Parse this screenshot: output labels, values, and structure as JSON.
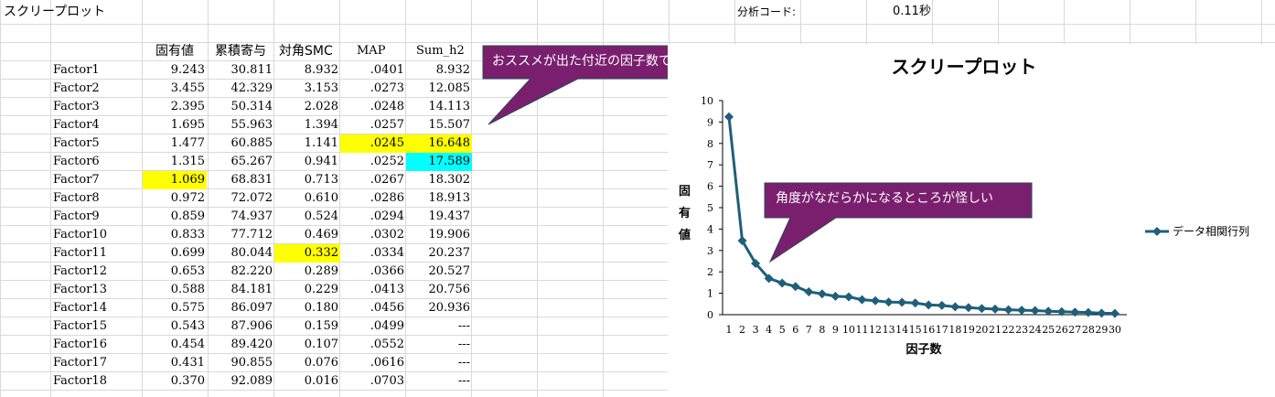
{
  "sheet": {
    "title": "スクリープロット",
    "analysis_code_label": "分析コード:",
    "analysis_time": "0.11秒"
  },
  "table": {
    "headers": [
      "固有値",
      "累積寄与",
      "対角SMC",
      "MAP",
      "Sum_h2"
    ],
    "rows": [
      {
        "factor": "Factor1",
        "eig": "9.243",
        "cum": "30.811",
        "smc": "8.932",
        "map": ".0401",
        "h2": "8.932"
      },
      {
        "factor": "Factor2",
        "eig": "3.455",
        "cum": "42.329",
        "smc": "3.153",
        "map": ".0273",
        "h2": "12.085"
      },
      {
        "factor": "Factor3",
        "eig": "2.395",
        "cum": "50.314",
        "smc": "2.028",
        "map": ".0248",
        "h2": "14.113"
      },
      {
        "factor": "Factor4",
        "eig": "1.695",
        "cum": "55.963",
        "smc": "1.394",
        "map": ".0257",
        "h2": "15.507"
      },
      {
        "factor": "Factor5",
        "eig": "1.477",
        "cum": "60.885",
        "smc": "1.141",
        "map": ".0245",
        "h2": "16.648"
      },
      {
        "factor": "Factor6",
        "eig": "1.315",
        "cum": "65.267",
        "smc": "0.941",
        "map": ".0252",
        "h2": "17.589"
      },
      {
        "factor": "Factor7",
        "eig": "1.069",
        "cum": "68.831",
        "smc": "0.713",
        "map": ".0267",
        "h2": "18.302"
      },
      {
        "factor": "Factor8",
        "eig": "0.972",
        "cum": "72.072",
        "smc": "0.610",
        "map": ".0286",
        "h2": "18.913"
      },
      {
        "factor": "Factor9",
        "eig": "0.859",
        "cum": "74.937",
        "smc": "0.524",
        "map": ".0294",
        "h2": "19.437"
      },
      {
        "factor": "Factor10",
        "eig": "0.833",
        "cum": "77.712",
        "smc": "0.469",
        "map": ".0302",
        "h2": "19.906"
      },
      {
        "factor": "Factor11",
        "eig": "0.699",
        "cum": "80.044",
        "smc": "0.332",
        "map": ".0334",
        "h2": "20.237"
      },
      {
        "factor": "Factor12",
        "eig": "0.653",
        "cum": "82.220",
        "smc": "0.289",
        "map": ".0366",
        "h2": "20.527"
      },
      {
        "factor": "Factor13",
        "eig": "0.588",
        "cum": "84.181",
        "smc": "0.229",
        "map": ".0413",
        "h2": "20.756"
      },
      {
        "factor": "Factor14",
        "eig": "0.575",
        "cum": "86.097",
        "smc": "0.180",
        "map": ".0456",
        "h2": "20.936"
      },
      {
        "factor": "Factor15",
        "eig": "0.543",
        "cum": "87.906",
        "smc": "0.159",
        "map": ".0499",
        "h2": "---"
      },
      {
        "factor": "Factor16",
        "eig": "0.454",
        "cum": "89.420",
        "smc": "0.107",
        "map": ".0552",
        "h2": "---"
      },
      {
        "factor": "Factor17",
        "eig": "0.431",
        "cum": "90.855",
        "smc": "0.076",
        "map": ".0616",
        "h2": "---"
      },
      {
        "factor": "Factor18",
        "eig": "0.370",
        "cum": "92.089",
        "smc": "0.016",
        "map": ".0703",
        "h2": "---"
      }
    ],
    "highlights": [
      {
        "row": 4,
        "col": "map",
        "color": "#ffff00"
      },
      {
        "row": 4,
        "col": "h2",
        "color": "#ffff00"
      },
      {
        "row": 5,
        "col": "h2",
        "color": "#00ffff"
      },
      {
        "row": 6,
        "col": "eig",
        "color": "#ffff00"
      },
      {
        "row": 10,
        "col": "smc",
        "color": "#ffff00"
      }
    ]
  },
  "callouts": {
    "top": "おススメが出た付近の因子数でやってみる",
    "chart": "角度がなだらかになるところが怪しい",
    "fill_color": "#7a1f6e"
  },
  "chart_data": {
    "type": "line",
    "title": "スクリープロット",
    "xlabel": "因子数",
    "ylabel": "固有値",
    "ylim": [
      0,
      10
    ],
    "yticks": [
      0,
      1,
      2,
      3,
      4,
      5,
      6,
      7,
      8,
      9,
      10
    ],
    "x": [
      1,
      2,
      3,
      4,
      5,
      6,
      7,
      8,
      9,
      10,
      11,
      12,
      13,
      14,
      15,
      16,
      17,
      18,
      19,
      20,
      21,
      22,
      23,
      24,
      25,
      26,
      27,
      28,
      29,
      30
    ],
    "series": [
      {
        "name": "データ相関行列",
        "color": "#1f5f7a",
        "values": [
          9.243,
          3.455,
          2.395,
          1.695,
          1.477,
          1.315,
          1.069,
          0.972,
          0.859,
          0.833,
          0.699,
          0.653,
          0.588,
          0.575,
          0.543,
          0.454,
          0.431,
          0.37,
          0.33,
          0.29,
          0.26,
          0.23,
          0.21,
          0.19,
          0.16,
          0.14,
          0.12,
          0.1,
          0.07,
          0.06
        ]
      }
    ],
    "legend": "right"
  }
}
